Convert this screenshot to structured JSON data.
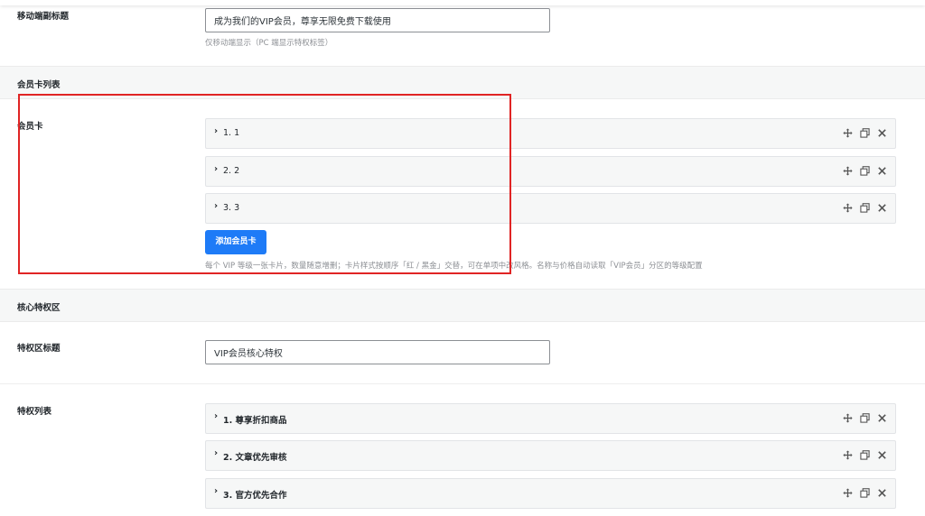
{
  "mobile_subtitle": {
    "label": "移动端副标题",
    "value": "成为我们的VIP会员，尊享无限免费下载使用",
    "help": "仅移动端显示（PC 端显示特权标签）"
  },
  "card_section": {
    "title": "会员卡列表",
    "field_label": "会员卡",
    "items": [
      {
        "label": "1. 1"
      },
      {
        "label": "2. 2"
      },
      {
        "label": "3. 3"
      }
    ],
    "add_button": "添加会员卡",
    "help": "每个 VIP 等级一张卡片，数量随意增删；卡片样式按顺序「红 / 黑金」交替，可在单项中改风格。名称与价格自动读取「VIP会员」分区的等级配置"
  },
  "privilege_section": {
    "title": "核心特权区",
    "title_field": {
      "label": "特权区标题",
      "value": "VIP会员核心特权"
    },
    "list_label": "特权列表",
    "items": [
      {
        "label": "1. 尊享折扣商品"
      },
      {
        "label": "2. 文章优先审核"
      },
      {
        "label": "3. 官方优先合作"
      }
    ]
  },
  "icons": {
    "caret": "chevron-right-icon",
    "move": "move-icon",
    "copy": "duplicate-icon",
    "remove": "close-icon"
  },
  "colors": {
    "primary_button": "#1e7bf7",
    "highlight": "#e02424",
    "section_bg": "#f6f7f7"
  }
}
